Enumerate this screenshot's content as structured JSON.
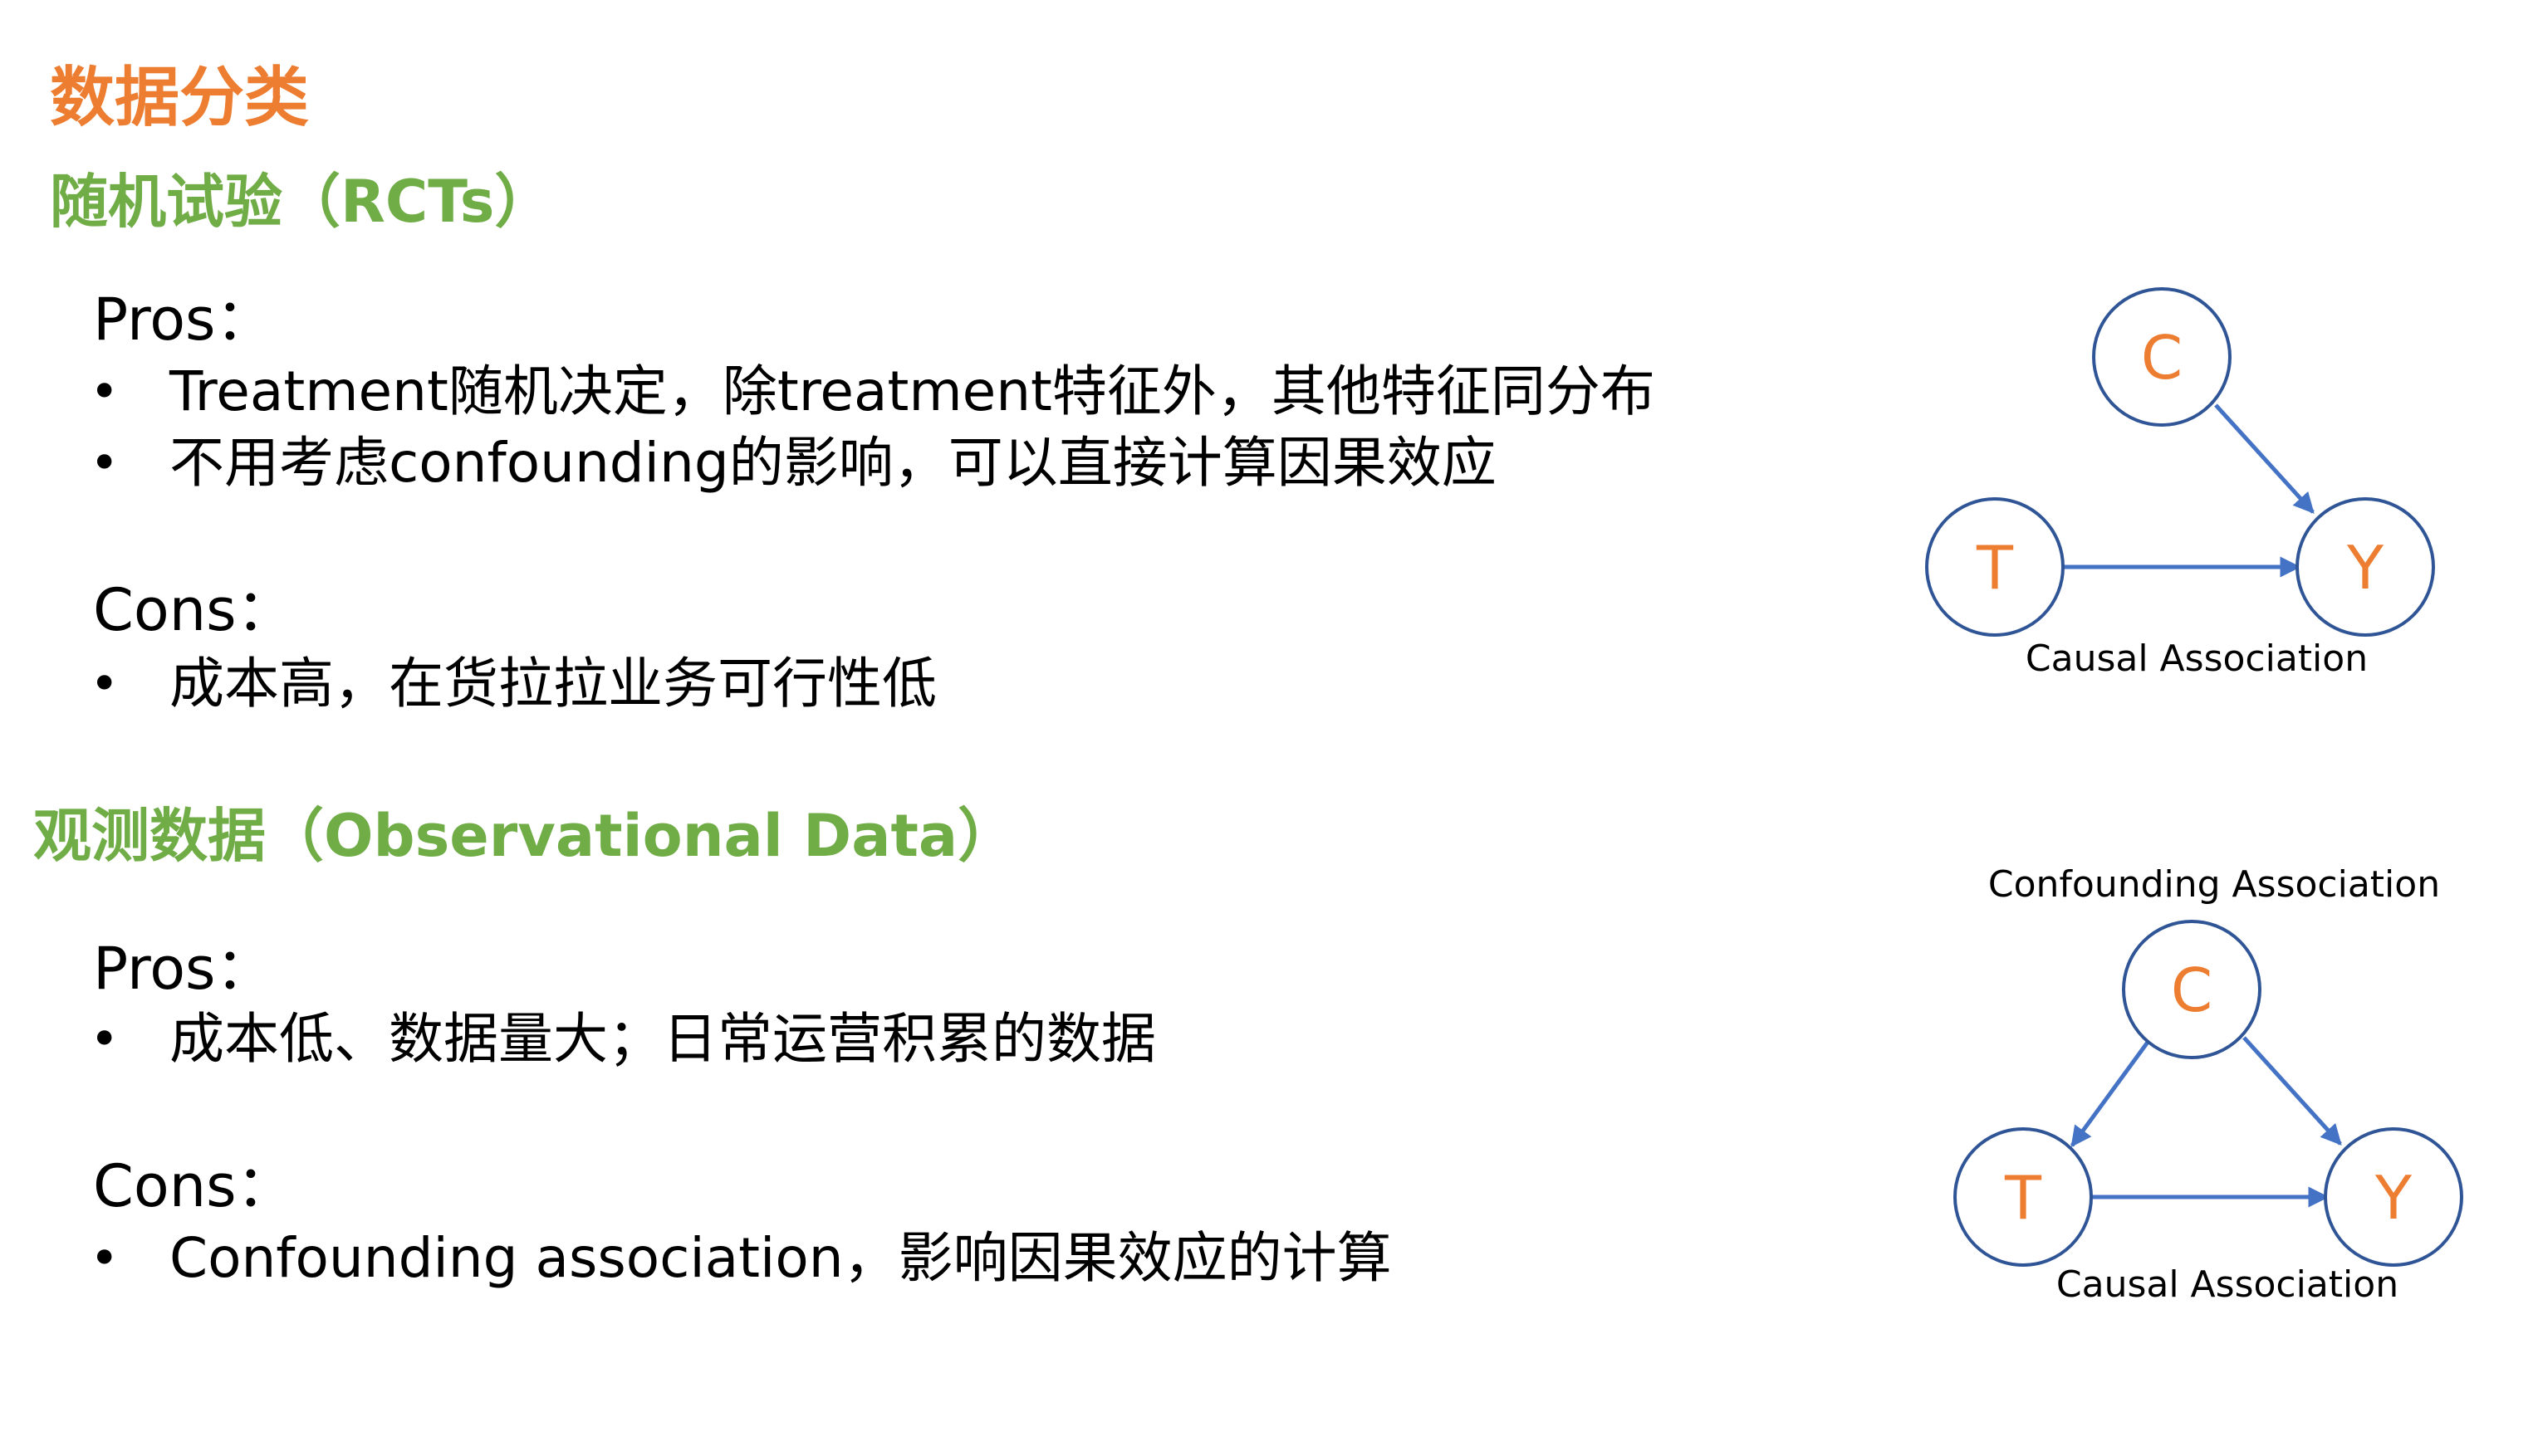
{
  "title": "数据分类",
  "rct": {
    "heading": "随机试验（RCTs）",
    "pros_label": "Pros：",
    "pros": [
      "Treatment随机决定，除treatment特征外，其他特征同分布",
      "不用考虑confounding的影响，可以直接计算因果效应"
    ],
    "cons_label": "Cons：",
    "cons": [
      "成本高，在货拉拉业务可行性低"
    ],
    "diagram": {
      "nodes": {
        "c": "C",
        "t": "T",
        "y": "Y"
      },
      "causal_label": "Causal Association"
    }
  },
  "observational": {
    "heading": "观测数据（Observational Data）",
    "pros_label": "Pros：",
    "pros": [
      "成本低、数据量大；日常运营积累的数据"
    ],
    "cons_label": "Cons：",
    "cons": [
      "Confounding association，影响因果效应的计算"
    ],
    "diagram": {
      "nodes": {
        "c": "C",
        "t": "T",
        "y": "Y"
      },
      "confounding_label": "Confounding Association",
      "causal_label": "Causal Association"
    }
  },
  "bullet_glyph": "•",
  "colors": {
    "title": "#ed7d31",
    "section": "#70ad47",
    "node_text": "#ed7d31",
    "node_stroke": "#2f5597",
    "edge": "#4472c4"
  }
}
